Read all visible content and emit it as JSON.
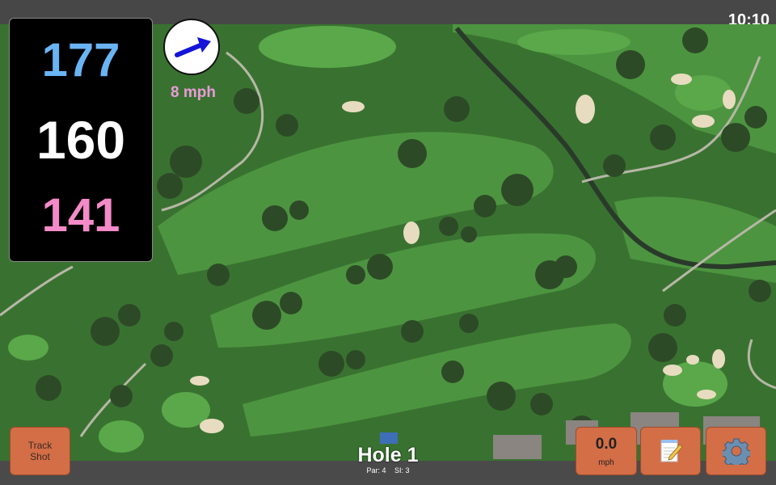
{
  "status_bar": {
    "time": "10:10"
  },
  "yardages": {
    "back": "177",
    "middle": "160",
    "front": "141"
  },
  "wind": {
    "speed_label": "8 mph",
    "speed_value": "0.0",
    "unit": "mph",
    "direction": "east-northeast"
  },
  "buttons": {
    "track_shot_line1": "Track",
    "track_shot_line2": "Shot",
    "notes_icon": "notepad-icon",
    "settings_icon": "gear-icon"
  },
  "hole": {
    "title": "Hole 1",
    "par": "Par: 4",
    "si": "SI: 3"
  },
  "colors": {
    "back": "#6ab4f4",
    "middle": "#ffffff",
    "front": "#f48bc8",
    "button": "#d36e47",
    "wind_text": "#ea9bd8"
  }
}
